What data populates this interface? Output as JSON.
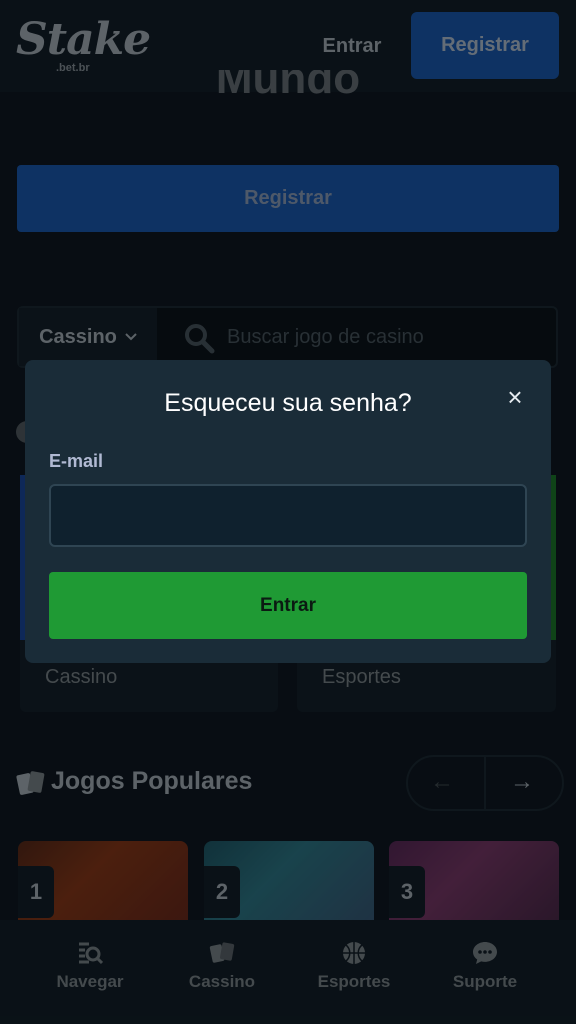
{
  "header": {
    "logo_text": "Stake",
    "logo_sub": ".bet.br",
    "login_label": "Entrar",
    "register_label": "Registrar"
  },
  "hero": {
    "title_partial": "Mundo",
    "register_label": "Registrar"
  },
  "search": {
    "category_selected": "Cassino",
    "placeholder": "Buscar jogo de casino"
  },
  "cards": {
    "casino_label": "Cassino",
    "sports_label": "Esportes"
  },
  "popular": {
    "title": "Jogos Populares",
    "prev_arrow": "←",
    "next_arrow": "→",
    "ranks": [
      "1",
      "2",
      "3"
    ]
  },
  "modal": {
    "title": "Esqueceu sua senha?",
    "close_glyph": "×",
    "email_label": "E-mail",
    "email_value": "",
    "submit_label": "Entrar"
  },
  "bottom_nav": {
    "items": [
      {
        "label": "Navegar",
        "icon": "browse-icon"
      },
      {
        "label": "Cassino",
        "icon": "cards-icon"
      },
      {
        "label": "Esportes",
        "icon": "basketball-icon"
      },
      {
        "label": "Suporte",
        "icon": "chat-icon"
      }
    ]
  },
  "colors": {
    "background": "#0f1923",
    "header": "#13202a",
    "brand_blue": "#1a5bb4",
    "success_green": "#1f9a34",
    "modal_bg": "#1a2c38"
  }
}
